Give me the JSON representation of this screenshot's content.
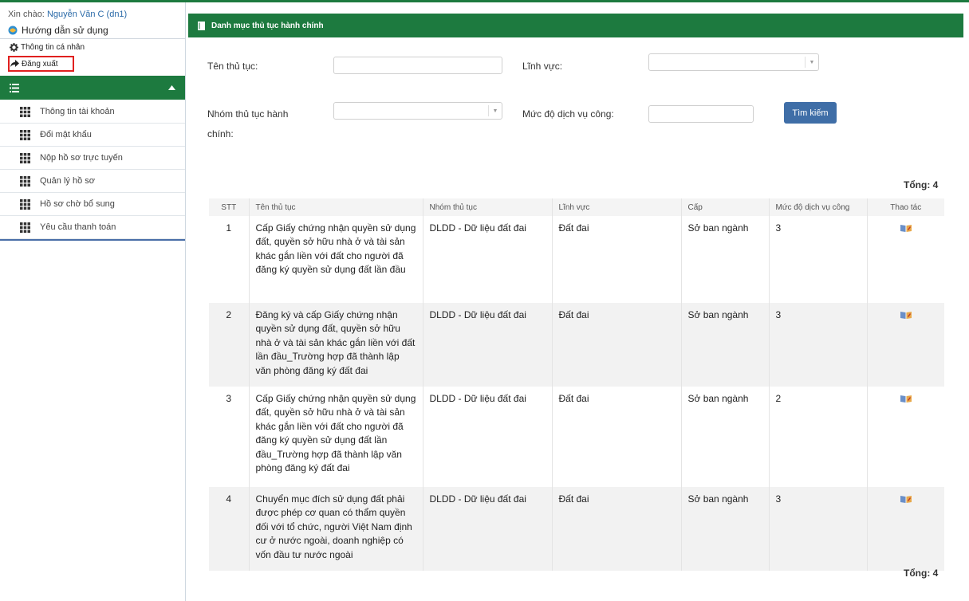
{
  "user": {
    "greeting": "Xin chào:",
    "name": "Nguyễn Văn C (dn1)",
    "guide": "Hướng dẫn sử dụng",
    "profile": "Thông tin cá nhân",
    "logout": "Đăng xuất"
  },
  "menu": {
    "items": [
      {
        "label": "Thông tin tài khoản"
      },
      {
        "label": "Đổi mật khẩu"
      },
      {
        "label": "Nộp hồ sơ trực tuyến"
      },
      {
        "label": "Quản lý hồ sơ"
      },
      {
        "label": "Hồ sơ chờ bổ sung"
      },
      {
        "label": "Yêu cầu thanh toán"
      }
    ]
  },
  "panel": {
    "title": "Danh mục thủ tục hành chính"
  },
  "form": {
    "name_label": "Tên thủ tục:",
    "name_value": "",
    "field_label": "Lĩnh vực:",
    "field_value": "",
    "group_label_1": "Nhóm thủ tục hành",
    "group_label_2": "chính:",
    "group_value": "",
    "level_label": "Mức độ dịch vụ công:",
    "level_value": "",
    "search_button": "Tìm kiếm"
  },
  "total_label": "Tổng: 4",
  "table": {
    "headers": [
      "STT",
      "Tên thủ tục",
      "Nhóm thủ tục",
      "Lĩnh vực",
      "Cấp",
      "Mức độ dịch vụ công",
      "Thao tác"
    ],
    "rows": [
      {
        "stt": "1",
        "name": "Cấp Giấy chứng nhận quyền sử dụng đất, quyền sở hữu nhà ở và tài sản khác gắn liền với đất cho người đã đăng ký quyền sử dụng đất lần đầu",
        "group": "DLDD - Dữ liệu đất đai",
        "field": "Đất đai",
        "level": "Sở ban ngành",
        "service": "3"
      },
      {
        "stt": "2",
        "name": "Đăng ký và cấp Giấy chứng nhận quyền sử dụng đất, quyền sở hữu nhà ở và tài sản khác gắn liền với đất lần đầu_Trường hợp đã thành lập văn phòng đăng ký đất đai",
        "group": "DLDD - Dữ liệu đất đai",
        "field": "Đất đai",
        "level": "Sở ban ngành",
        "service": "3"
      },
      {
        "stt": "3",
        "name": "Cấp Giấy chứng nhận quyền sử dụng đất, quyền sở hữu nhà ở và tài sản khác gắn liền với đất cho người đã đăng ký quyền sử dụng đất lần đầu_Trường hợp đã thành lập văn phòng đăng ký đất đai",
        "group": "DLDD - Dữ liệu đất đai",
        "field": "Đất đai",
        "level": "Sở ban ngành",
        "service": "2"
      },
      {
        "stt": "4",
        "name": "Chuyển mục đích sử dụng đất phải được phép cơ quan có thẩm quyền đối với tổ chức, người Việt Nam định cư ở nước ngoài, doanh nghiệp có vốn đầu tư nước ngoài",
        "group": "DLDD - Dữ liệu đất đai",
        "field": "Đất đai",
        "level": "Sở ban ngành",
        "service": "3"
      }
    ]
  },
  "colors": {
    "brand_green": "#1d7a3f",
    "button_blue": "#3f6ea7",
    "highlight_red": "#e0201f"
  }
}
